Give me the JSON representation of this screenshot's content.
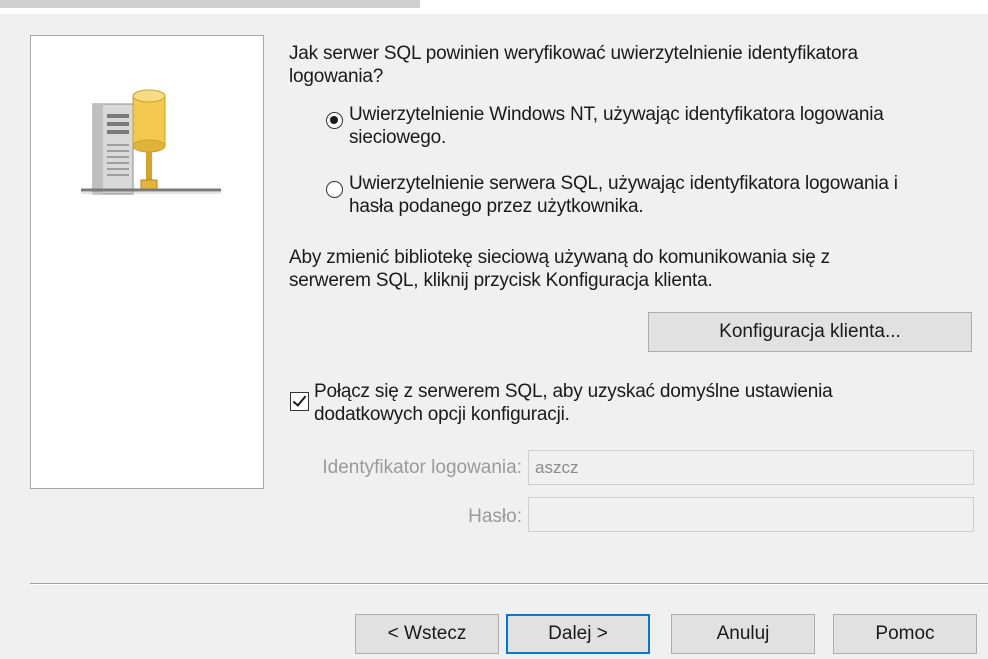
{
  "question": {
    "line1": "Jak serwer SQL powinien weryfikować uwierzytelnienie identyfikatora",
    "line2": "logowania?"
  },
  "auth_options": [
    {
      "line1": "Uwierzytelnienie Windows NT, używając identyfikatora logowania",
      "line2": "sieciowego.",
      "selected": true
    },
    {
      "line1": "Uwierzytelnienie serwera SQL, używając identyfikatora logowania i",
      "line2": "hasła podanego przez użytkownika.",
      "selected": false
    }
  ],
  "network_info": {
    "line1": "Aby zmienić bibliotekę sieciową używaną do komunikowania się z",
    "line2": "serwerem SQL, kliknij przycisk Konfiguracja klienta."
  },
  "client_config_button": "Konfiguracja klienta...",
  "connect_checkbox": {
    "line1": "Połącz się z serwerem SQL, aby uzyskać domyślne ustawienia",
    "line2": "dodatkowych opcji konfiguracji.",
    "checked": true
  },
  "login_field": {
    "label": "Identyfikator logowania:",
    "value": "aszcz"
  },
  "password_field": {
    "label": "Hasło:",
    "value": ""
  },
  "buttons": {
    "back": "< Wstecz",
    "next": "Dalej >",
    "cancel": "Anuluj",
    "help": "Pomoc"
  },
  "colors": {
    "dialog_bg": "#f0f0f0",
    "default_button_border": "#0078d7",
    "disabled_text": "#9a9a9a",
    "server_cylinder": "#f2c94c"
  },
  "icons": {
    "server": "server-network-icon"
  }
}
